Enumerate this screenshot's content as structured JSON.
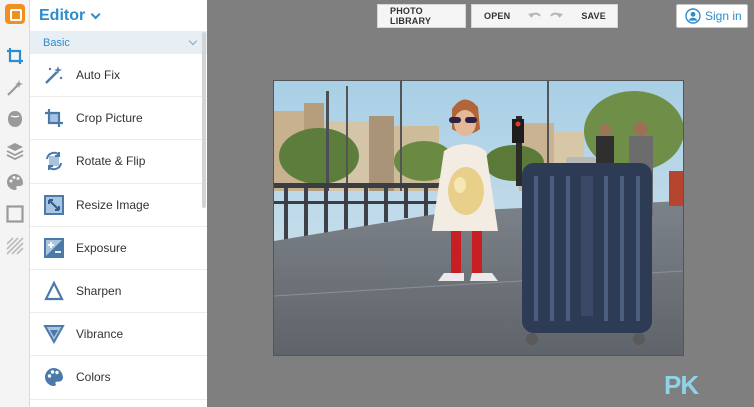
{
  "editor": {
    "title": "Editor",
    "section_label": "Basic",
    "tools": [
      {
        "label": "Auto Fix",
        "icon": "magic-wand-icon"
      },
      {
        "label": "Crop Picture",
        "icon": "crop-icon"
      },
      {
        "label": "Rotate & Flip",
        "icon": "rotate-icon"
      },
      {
        "label": "Resize Image",
        "icon": "resize-icon"
      },
      {
        "label": "Exposure",
        "icon": "exposure-icon"
      },
      {
        "label": "Sharpen",
        "icon": "sharpen-icon"
      },
      {
        "label": "Vibrance",
        "icon": "vibrance-icon"
      },
      {
        "label": "Colors",
        "icon": "palette-icon"
      }
    ]
  },
  "rail": {
    "items": [
      "crop-icon",
      "magic-wand-icon",
      "face-icon",
      "layers-icon",
      "palette-icon",
      "frame-icon",
      "texture-icon"
    ]
  },
  "toolbar": {
    "photo_library": "PHOTO LIBRARY",
    "open": "OPEN",
    "save": "SAVE"
  },
  "account": {
    "signin": "Sign in"
  },
  "watermark": {
    "text": "PK"
  },
  "colors": {
    "accent": "#2d8ccc",
    "logo": "#f0901e",
    "workspace": "#7f7f7f"
  }
}
